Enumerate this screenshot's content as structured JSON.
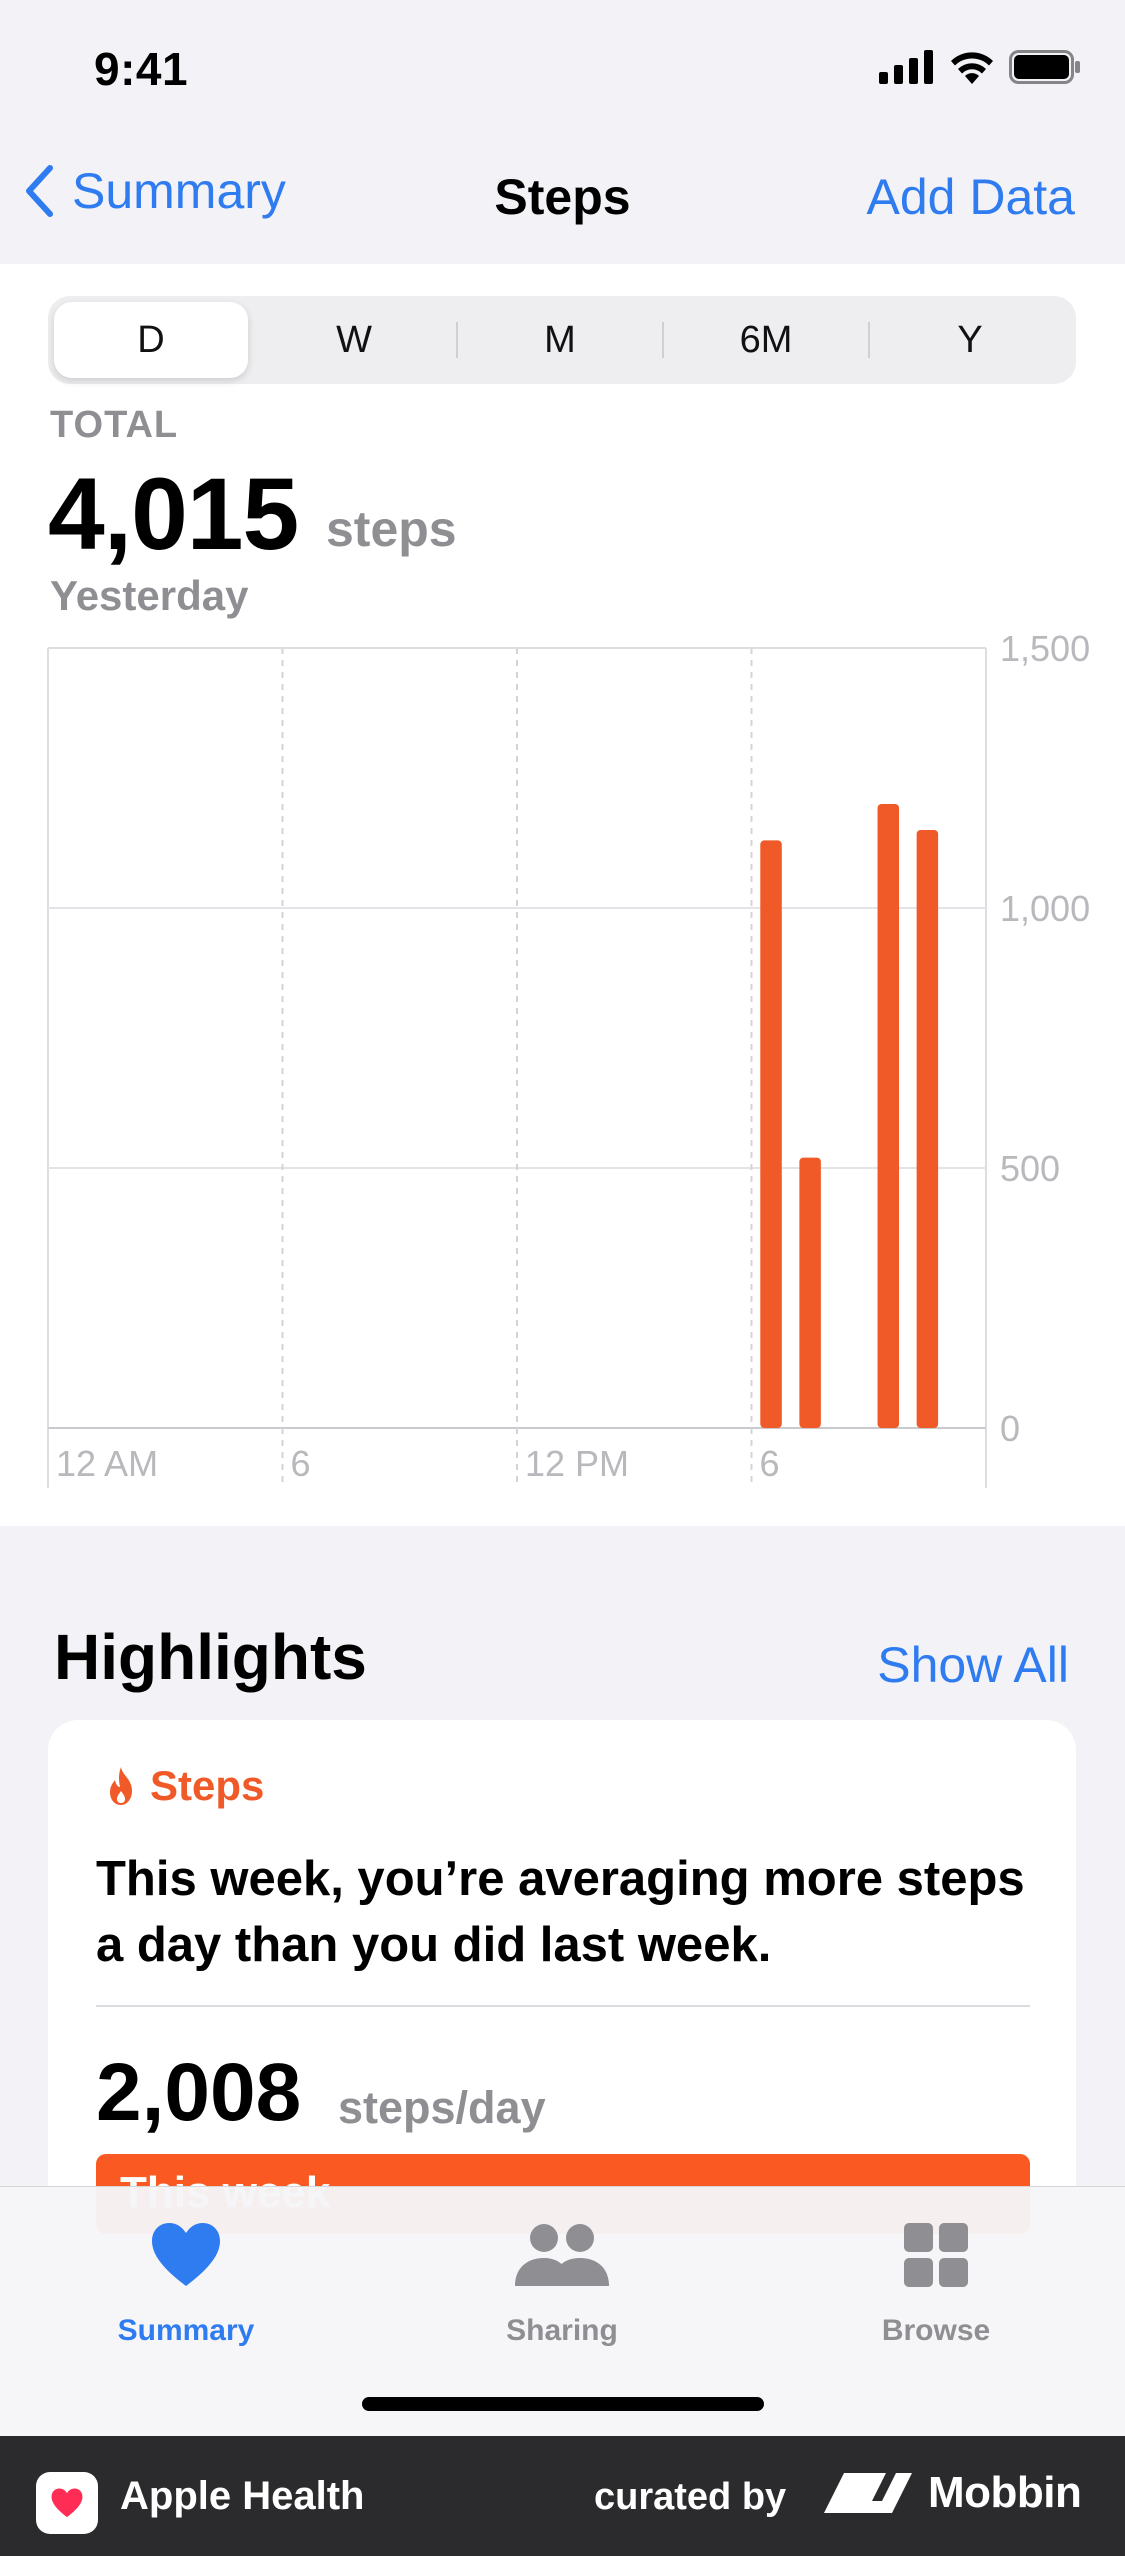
{
  "status_bar": {
    "time": "9:41"
  },
  "nav": {
    "back_label": "Summary",
    "title": "Steps",
    "action_label": "Add Data"
  },
  "segments": [
    {
      "label": "D",
      "active": true
    },
    {
      "label": "W",
      "active": false
    },
    {
      "label": "M",
      "active": false
    },
    {
      "label": "6M",
      "active": false
    },
    {
      "label": "Y",
      "active": false
    }
  ],
  "summary": {
    "label": "TOTAL",
    "value": "4,015",
    "unit": "steps",
    "date": "Yesterday"
  },
  "chart_data": {
    "type": "bar",
    "x_tick_labels": [
      "12 AM",
      "6",
      "12 PM",
      "6"
    ],
    "y_tick_labels": [
      "1,500",
      "1,000",
      "500",
      "0"
    ],
    "y_ticks": [
      1500,
      1000,
      500,
      0
    ],
    "ylim": [
      0,
      1500
    ],
    "xlim_hours": [
      0,
      24
    ],
    "grid": true,
    "bar_color": "#f05a28",
    "bars": [
      {
        "hour": 18,
        "value": 1130
      },
      {
        "hour": 19,
        "value": 520
      },
      {
        "hour": 21,
        "value": 1200
      },
      {
        "hour": 22,
        "value": 1150
      }
    ]
  },
  "highlights": {
    "title": "Highlights",
    "show_all": "Show All",
    "card": {
      "category": "Steps",
      "category_icon": "flame-icon",
      "text": "This week, you’re averaging more steps a day than you did last week.",
      "value": "2,008",
      "unit": "steps/day",
      "bar_label": "This week"
    }
  },
  "tabs": [
    {
      "label": "Summary",
      "icon": "heart-icon",
      "active": true
    },
    {
      "label": "Sharing",
      "icon": "people-icon",
      "active": false
    },
    {
      "label": "Browse",
      "icon": "grid-icon",
      "active": false
    }
  ],
  "footer": {
    "app_name": "Apple Health",
    "curated_by": "curated by",
    "brand": "Mobbin"
  },
  "colors": {
    "accent": "#2f7bf0",
    "steps_orange": "#f05a28"
  }
}
